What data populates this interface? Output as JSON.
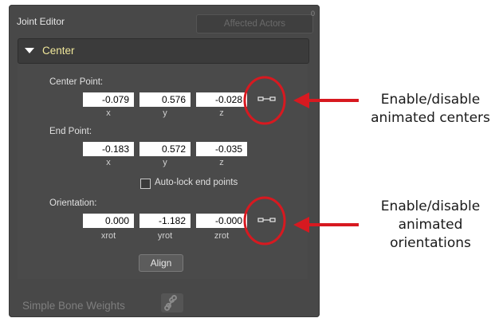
{
  "window": {
    "title": "Joint Editor",
    "affected_button": "Affected Actors",
    "corner_mark": "0"
  },
  "section": {
    "label": "Center"
  },
  "center_point": {
    "label": "Center Point:",
    "x": "-0.079",
    "y": "0.576",
    "z": "-0.028"
  },
  "end_point": {
    "label": "End Point:",
    "x": "-0.183",
    "y": "0.572",
    "z": "-0.035"
  },
  "axes": {
    "x": "x",
    "y": "y",
    "z": "z",
    "xrot": "xrot",
    "yrot": "yrot",
    "zrot": "zrot"
  },
  "autolock": {
    "label": "Auto-lock end points",
    "checked": false
  },
  "orientation": {
    "label": "Orientation:",
    "xrot": "0.000",
    "yrot": "-1.182",
    "zrot": "-0.000"
  },
  "align_button": "Align",
  "simple_bone_weights": "Simple Bone Weights",
  "annotations": {
    "centers": [
      "Enable/disable",
      "animated centers"
    ],
    "orientations": [
      "Enable/disable",
      "animated",
      "orientations"
    ]
  },
  "colors": {
    "highlight": "#d71920",
    "section_label": "#f0e79a"
  },
  "icons": {
    "center_anim": "glasses-icon",
    "orientation_anim": "glasses-icon",
    "bone_weights": "bone-icon"
  }
}
